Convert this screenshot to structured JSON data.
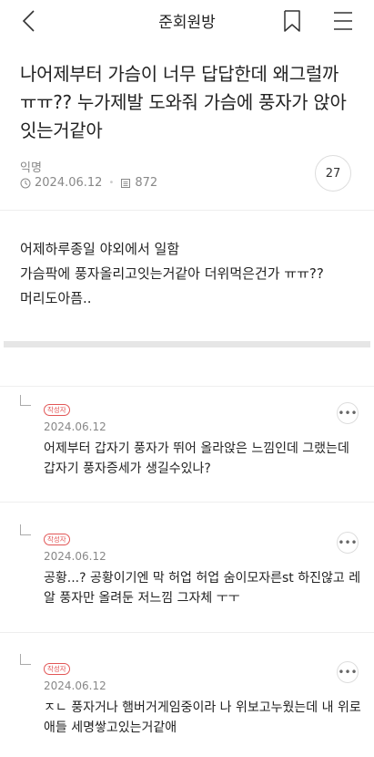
{
  "header": {
    "title": "준회원방",
    "back_icon": "chevron-left-icon",
    "bookmark_icon": "bookmark-icon",
    "menu_icon": "hamburger-menu-icon"
  },
  "post": {
    "title": "나어제부터 가슴이 너무 답답한데 왜그럴까 ㅠㅠ?? 누가제발 도와줘 가슴에 풍자가 앉아잇는거같아",
    "author": "익명",
    "date": "2024.06.12",
    "views": "872",
    "comment_count": "27",
    "body": [
      "어제하루종일 야외에서 일함",
      "가슴팍에 풍자올리고잇는거같아 더위먹은건가 ㅠㅠ??",
      "머리도아픔.."
    ]
  },
  "comments": [
    {
      "badge": "작성자",
      "date": "2024.06.12",
      "text": "어제부터 갑자기 풍자가 뛰어 올라앉은 느낌인데 그랬는데 갑자기 풍자증세가 생길수있나?"
    },
    {
      "badge": "작성자",
      "date": "2024.06.12",
      "text": "공황...? 공황이기엔 막 허업 허업 숨이모자른st 하진않고 레알 풍자만 올려둔 저느낌 그자체 ㅜㅜ"
    },
    {
      "badge": "작성자",
      "date": "2024.06.12",
      "text": "ㅈㄴ 풍자거나 햄버거게임중이라 나 위보고누웠는데 내 위로 애들 세명쌓고있는거같애"
    }
  ],
  "more_icon": "more-horizontal-icon"
}
